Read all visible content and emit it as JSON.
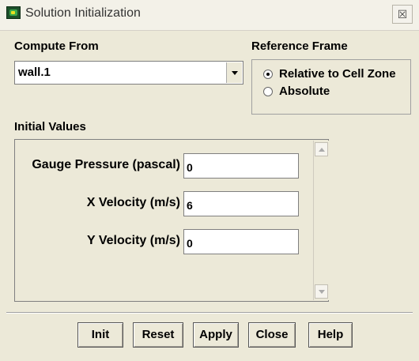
{
  "window": {
    "title": "Solution Initialization",
    "close_label": "☒"
  },
  "compute_from": {
    "label": "Compute From",
    "selected": "wall.1"
  },
  "reference_frame": {
    "label": "Reference Frame",
    "options": [
      {
        "label": "Relative to Cell Zone",
        "checked": true
      },
      {
        "label": "Absolute",
        "checked": false
      }
    ]
  },
  "initial_values": {
    "label": "Initial Values",
    "fields": [
      {
        "label": "Gauge Pressure (pascal)",
        "value": "0"
      },
      {
        "label": "X Velocity (m/s)",
        "value": "6"
      },
      {
        "label": "Y Velocity (m/s)",
        "value": "0"
      }
    ]
  },
  "buttons": {
    "init": "Init",
    "reset": "Reset",
    "apply": "Apply",
    "close": "Close",
    "help": "Help"
  }
}
